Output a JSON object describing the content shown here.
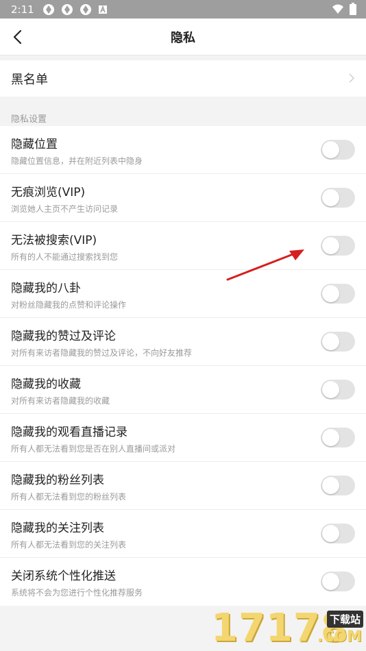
{
  "status_bar": {
    "time": "2:11",
    "icons": [
      "app-notification-icon",
      "app-notification-icon",
      "app-notification-icon",
      "a-badge-icon"
    ],
    "right_icons": [
      "wifi-icon",
      "battery-icon"
    ]
  },
  "header": {
    "title": "隐私"
  },
  "blacklist": {
    "label": "黑名单"
  },
  "section": {
    "label": "隐私设置"
  },
  "settings": [
    {
      "title": "隐藏位置",
      "desc": "隐藏位置信息，并在附近列表中隐身",
      "enabled": false
    },
    {
      "title": "无痕浏览(VIP)",
      "desc": "浏览她人主页不产生访问记录",
      "enabled": false
    },
    {
      "title": "无法被搜索(VIP)",
      "desc": "所有的人不能通过搜索找到您",
      "enabled": false
    },
    {
      "title": "隐藏我的八卦",
      "desc": "对粉丝隐藏我的点赞和评论操作",
      "enabled": false
    },
    {
      "title": "隐藏我的赞过及评论",
      "desc": "对所有来访者隐藏我的赞过及评论，不向好友推荐",
      "enabled": false
    },
    {
      "title": "隐藏我的收藏",
      "desc": "对所有来访者隐藏我的收藏",
      "enabled": false
    },
    {
      "title": "隐藏我的观看直播记录",
      "desc": "所有人都无法看到您是否在别人直播间或派对",
      "enabled": false
    },
    {
      "title": "隐藏我的粉丝列表",
      "desc": "所有人都无法看到您的粉丝列表",
      "enabled": false
    },
    {
      "title": "隐藏我的关注列表",
      "desc": "所有人都无法看到您的关注列表",
      "enabled": false
    },
    {
      "title": "关闭系统个性化推送",
      "desc": "系统将不会为您进行个性化推荐服务",
      "enabled": false
    }
  ],
  "watermark": {
    "number": "17178",
    "badge": "下载站",
    "domain": ".COM"
  },
  "colors": {
    "toggle_off": "#e3e3e3",
    "annotation_arrow": "#d61f1f",
    "status_bar": "#9e9e9e"
  }
}
